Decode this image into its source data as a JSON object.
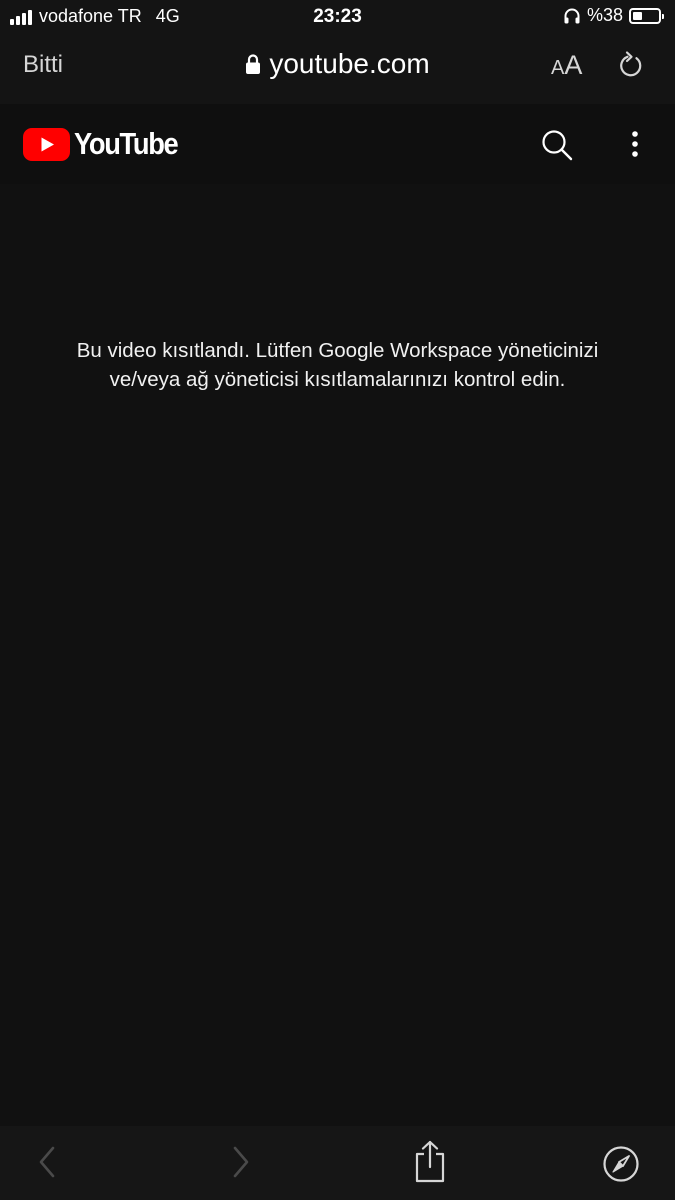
{
  "status_bar": {
    "carrier": "vodafone TR",
    "network": "4G",
    "time": "23:23",
    "battery_text": "%38",
    "battery_level": 0.38,
    "icons": [
      "signal-icon",
      "headphones-icon",
      "battery-icon"
    ]
  },
  "browser": {
    "done_label": "Bitti",
    "url": "youtube.com",
    "text_size_small": "A",
    "text_size_big": "A",
    "icons": [
      "lock-icon",
      "reload-icon"
    ]
  },
  "youtube_header": {
    "wordmark": "YouTube",
    "brand_color": "#ff0000",
    "icons": [
      "youtube-play-icon",
      "search-icon",
      "more-vertical-icon"
    ]
  },
  "message": {
    "line1": "Bu video kısıtlandı. Lütfen Google Workspace yöneticinizi",
    "line2": "ve/veya ağ yöneticisi kısıtlamalarınızı kontrol edin."
  },
  "toolbar": {
    "icons": [
      "back-arrow-icon",
      "forward-arrow-icon",
      "share-icon",
      "compass-icon"
    ]
  }
}
